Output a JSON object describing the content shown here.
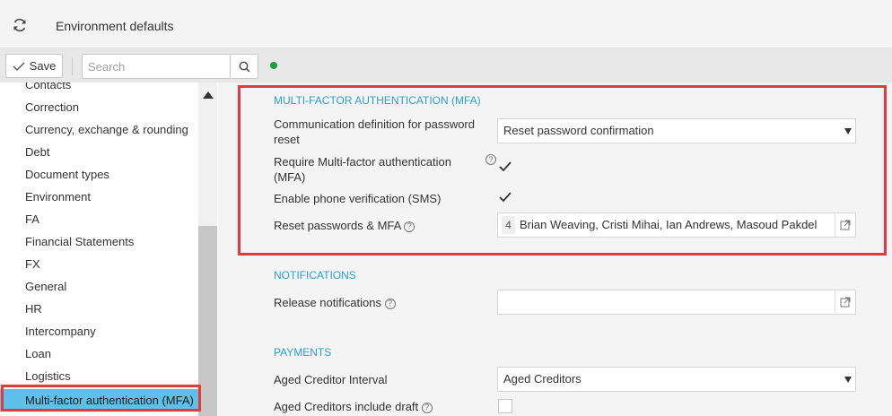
{
  "window": {
    "title": "Environment defaults"
  },
  "toolbar": {
    "save_label": "Save",
    "search_placeholder": "Search"
  },
  "sidebar": {
    "items": [
      "Contacts",
      "Correction",
      "Currency, exchange & rounding",
      "Debt",
      "Document types",
      "Environment",
      "FA",
      "Financial Statements",
      "FX",
      "General",
      "HR",
      "Intercompany",
      "Loan",
      "Logistics",
      "Multi-factor authentication (MFA)"
    ],
    "active_index": 14
  },
  "mfa": {
    "title": "MULTI-FACTOR AUTHENTICATION (MFA)",
    "comm_def_label": "Communication definition for password reset",
    "comm_def_value": "Reset password confirmation",
    "require_mfa_label": "Require Multi-factor authentication (MFA)",
    "require_mfa_checked": true,
    "sms_label": "Enable phone verification (SMS)",
    "sms_checked": true,
    "reset_label": "Reset passwords & MFA",
    "reset_count": "4",
    "reset_names": "Brian Weaving, Cristi Mihai, Ian Andrews, Masoud Pakdel"
  },
  "notifications": {
    "title": "NOTIFICATIONS",
    "release_label": "Release notifications",
    "release_value": ""
  },
  "payments": {
    "title": "PAYMENTS",
    "aged_interval_label": "Aged Creditor Interval",
    "aged_interval_value": "Aged Creditors",
    "include_draft_label": "Aged Creditors include draft",
    "include_draft_checked": false
  },
  "help_glyph": "?",
  "colors": {
    "accent": "#2aa0d0",
    "active_item": "#5cc0e8",
    "highlight": "#e23b3b",
    "status": "#1a9f3a"
  }
}
